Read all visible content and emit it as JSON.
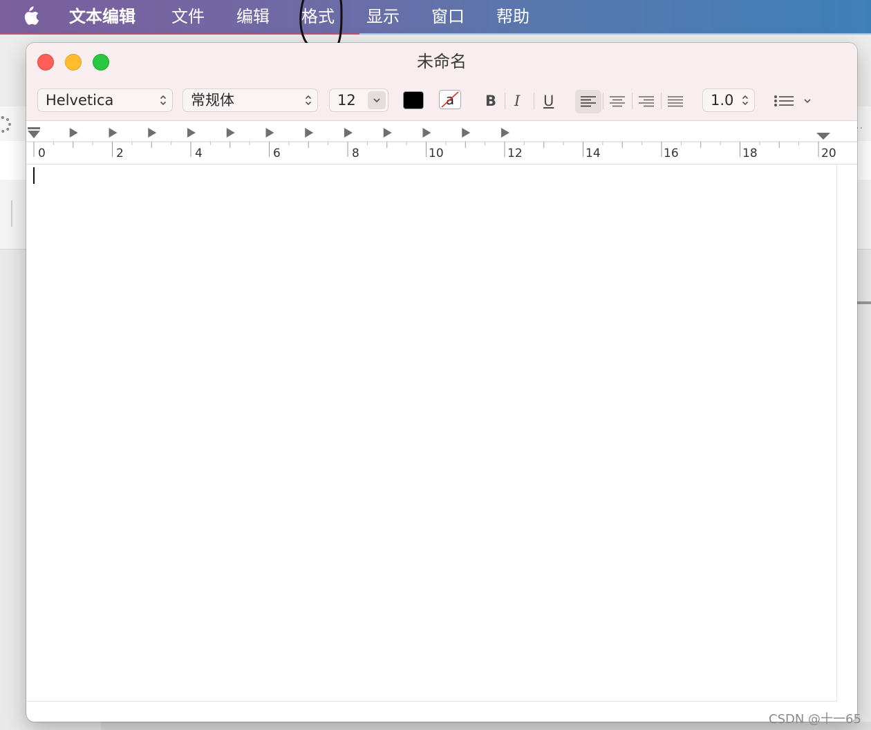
{
  "menubar": {
    "items": [
      {
        "label": "文本编辑"
      },
      {
        "label": "文件"
      },
      {
        "label": "编辑"
      },
      {
        "label": "格式"
      },
      {
        "label": "显示"
      },
      {
        "label": "窗口"
      },
      {
        "label": "帮助"
      }
    ]
  },
  "window": {
    "title": "未命名"
  },
  "toolbar": {
    "font_family": "Helvetica",
    "font_style": "常规体",
    "font_size": "12",
    "text_color": "#000000",
    "bg_color_glyph": "a",
    "bold_label": "B",
    "italic_label": "I",
    "underline_label": "U",
    "line_spacing": "1.0",
    "alignment_selected": "left"
  },
  "ruler": {
    "labels": [
      "0",
      "2",
      "4",
      "6",
      "8",
      "10",
      "12",
      "14",
      "16",
      "18",
      "20"
    ]
  },
  "document": {
    "content": ""
  },
  "watermark": "CSDN @十一65",
  "colors": {
    "close": "#fe5f57",
    "minimize": "#febc2e",
    "maximize": "#28c840"
  }
}
